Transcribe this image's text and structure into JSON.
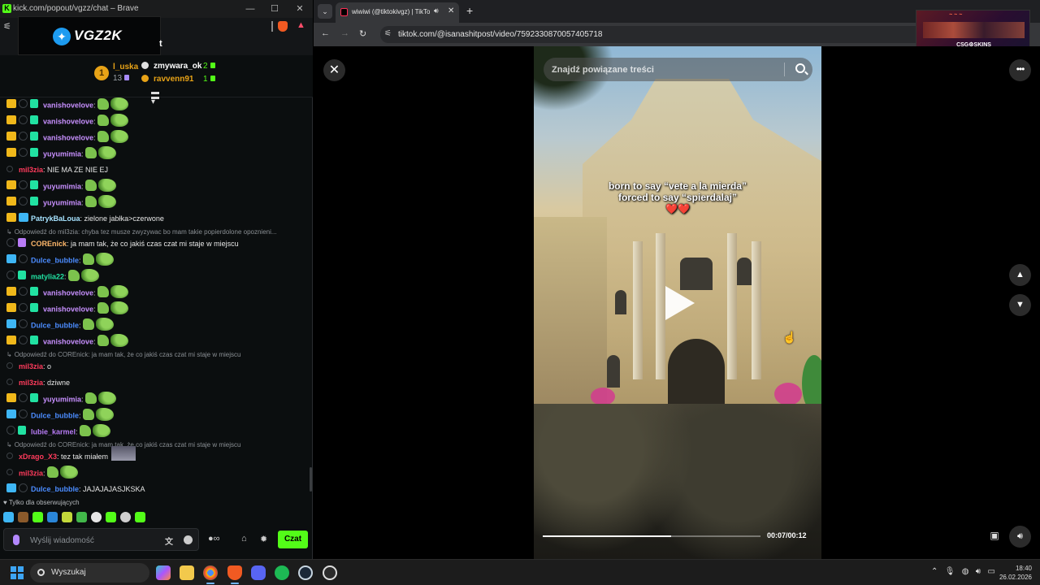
{
  "chat_window": {
    "title": "kick.com/popout/vgzz/chat – Brave",
    "favicon": "K",
    "logo_text": "VGZ2K",
    "logo_trailing": "t",
    "leaderboard": [
      {
        "rank": "1",
        "name": "l_uska",
        "count": "13"
      },
      {
        "name": "zmywara_ok",
        "count": "2"
      },
      {
        "name": "ravvenn91",
        "count": "1"
      }
    ],
    "messages": [
      {
        "user": "vanishovelove",
        "color": "#c890ff",
        "text": ":"
      },
      {
        "user": "vanishovelove",
        "color": "#c890ff",
        "text": ":"
      },
      {
        "user": "vanishovelove",
        "color": "#c890ff",
        "text": ":"
      },
      {
        "user": "yuyumimia",
        "color": "#c890ff",
        "text": ":"
      },
      {
        "user": "mil3zia",
        "color": "#ff3b5c",
        "text": ": NIE MA ZE NIE EJ"
      },
      {
        "user": "yuyumimia",
        "color": "#c890ff",
        "text": ":"
      },
      {
        "user": "yuyumimia",
        "color": "#c890ff",
        "text": ":"
      },
      {
        "user": "PatrykBaLoua",
        "color": "#a6e3ff",
        "text": ": zielone jabłka>czerwone"
      },
      {
        "user": "COREnick",
        "color": "#ffb86b",
        "text": ": ja mam tak, że co jakiś czas czat mi staje w miejscu",
        "reply": "Odpowiedź do mil3zia: chyba tez musze zwyzywac bo mam takie popierdolone opoznieni..."
      },
      {
        "user": "Dulce_bubble",
        "color": "#4b8cff",
        "text": ":"
      },
      {
        "user": "matylia22",
        "color": "#21e2a2",
        "text": ":"
      },
      {
        "user": "vanishovelove",
        "color": "#c890ff",
        "text": ":"
      },
      {
        "user": "vanishovelove",
        "color": "#c890ff",
        "text": ":"
      },
      {
        "user": "Dulce_bubble",
        "color": "#4b8cff",
        "text": ":"
      },
      {
        "user": "vanishovelove",
        "color": "#c890ff",
        "text": ":"
      },
      {
        "user": "mil3zia",
        "color": "#ff3b5c",
        "text": ": o",
        "reply": "Odpowiedź do COREnick: ja mam tak, że co jakiś czas czat mi staje w miejscu"
      },
      {
        "user": "mil3zia",
        "color": "#ff3b5c",
        "text": ": dziwne"
      },
      {
        "user": "yuyumimia",
        "color": "#c890ff",
        "text": ":"
      },
      {
        "user": "Dulce_bubble",
        "color": "#4b8cff",
        "text": ":"
      },
      {
        "user": "lubie_karmel",
        "color": "#b77bf5",
        "text": ":"
      },
      {
        "user": "xDrago_X3",
        "color": "#ff3b5c",
        "text": ": tez tak miałem",
        "reply": "Odpowiedź do COREnick: ja mam tak, że co jakiś czas czat mi staje w miejscu"
      },
      {
        "user": "mil3zia",
        "color": "#ff3b5c",
        "text": ":"
      },
      {
        "user": "Dulce_bubble",
        "color": "#4b8cff",
        "text": ": JAJAJAJASJKSKA"
      }
    ],
    "followers_only": "Tylko dla obserwujących",
    "input_placeholder": "Wyślij wiadomość",
    "send_label": "Czat"
  },
  "browser": {
    "tab_title": "wiwiwi (@tiktokivgz) | TikTok",
    "url": "tiktok.com/@isanashitpost/video/7592330870057405718"
  },
  "stream_overlay": {
    "brand": "CSG⚙SKINS"
  },
  "tiktok": {
    "search_placeholder": "Znajdź powiązane treści",
    "caption_line1": "born to say “vete a la mierda”",
    "caption_line2": "forced to say “spierdalaj”",
    "caption_hearts": "❤️❤️",
    "time": "00:07/00:12",
    "progress": 0.59
  },
  "taskbar": {
    "search_label": "Wyszukaj",
    "time": "18:40",
    "date": "26.02.2026"
  },
  "colors": {
    "kick_green": "#53fc18",
    "chat_bg": "#0b0e0f"
  }
}
